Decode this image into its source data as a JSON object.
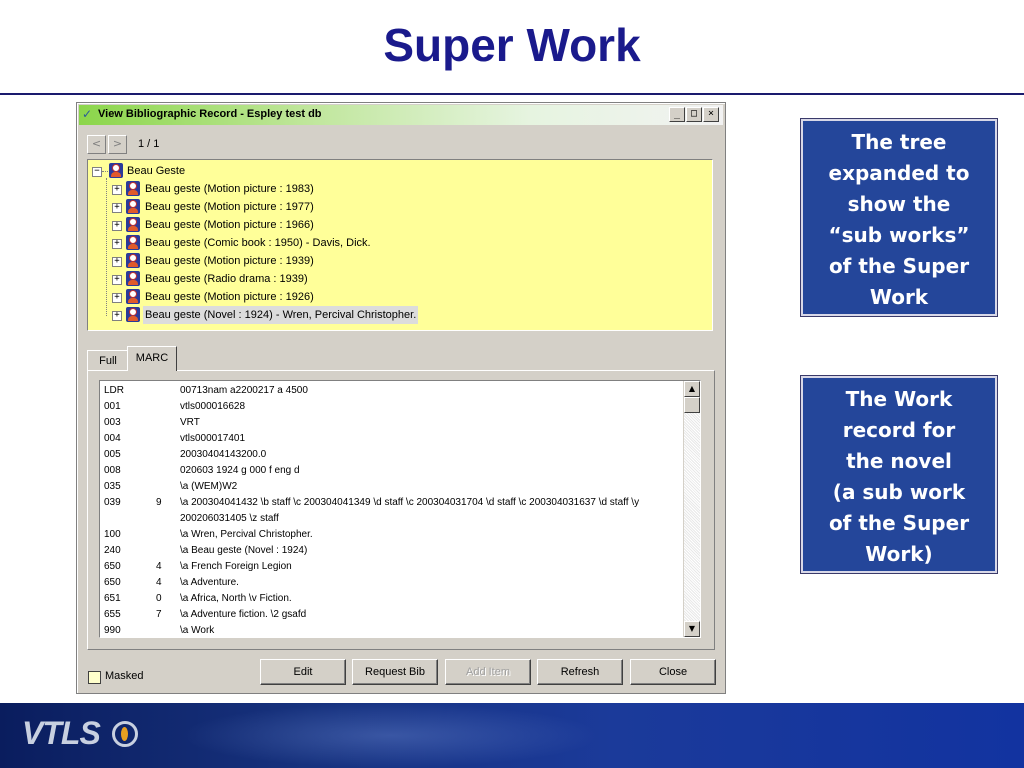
{
  "slide": {
    "title": "Super Work"
  },
  "window": {
    "title": "View Bibliographic Record - Espley test db",
    "buttons": {
      "minimize": "_",
      "maximize": "□",
      "close": "×"
    },
    "nav": {
      "prev": "<",
      "next": ">",
      "pager": "1 / 1"
    },
    "tree": {
      "root": "Beau Geste",
      "children": [
        "Beau geste (Motion picture : 1983)",
        "Beau geste (Motion picture : 1977)",
        "Beau geste (Motion picture : 1966)",
        "Beau geste (Comic book : 1950) - Davis, Dick.",
        "Beau geste (Motion picture : 1939)",
        "Beau geste (Radio drama : 1939)",
        "Beau geste (Motion picture : 1926)",
        "Beau geste (Novel : 1924) - Wren, Percival Christopher."
      ],
      "selected_index": 7
    },
    "tabs": {
      "full": "Full",
      "marc": "MARC",
      "active": "MARC"
    },
    "marc": [
      {
        "tag": "LDR",
        "ind": "",
        "val": "00713nam a2200217 a 4500"
      },
      {
        "tag": "001",
        "ind": "",
        "val": "vtls000016628"
      },
      {
        "tag": "003",
        "ind": "",
        "val": "VRT"
      },
      {
        "tag": "004",
        "ind": "",
        "val": "vtls000017401"
      },
      {
        "tag": "005",
        "ind": "",
        "val": "20030404143200.0"
      },
      {
        "tag": "008",
        "ind": "",
        "val": "020603 1924          g      000 f eng d"
      },
      {
        "tag": "035",
        "ind": "",
        "val": "\\a (WEM)W2"
      },
      {
        "tag": "039",
        "ind": "9",
        "val": "\\a 200304041432 \\b staff \\c 200304041349 \\d staff \\c 200304031704 \\d staff \\c 200304031637 \\d staff \\y"
      },
      {
        "tag": "",
        "ind": "",
        "val": "200206031405 \\z staff"
      },
      {
        "tag": "100",
        "ind": "",
        "val": "\\a Wren, Percival Christopher."
      },
      {
        "tag": "240",
        "ind": "",
        "val": "\\a Beau geste (Novel : 1924)"
      },
      {
        "tag": "650",
        "ind": "4",
        "val": "\\a French Foreign Legion"
      },
      {
        "tag": "650",
        "ind": "4",
        "val": "\\a Adventure."
      },
      {
        "tag": "651",
        "ind": "0",
        "val": "\\a Africa, North \\v Fiction."
      },
      {
        "tag": "655",
        "ind": "7",
        "val": "\\a Adventure fiction. \\2 gsafd"
      },
      {
        "tag": "990",
        "ind": "",
        "val": "\\a Work"
      }
    ],
    "masked_label": "Masked",
    "actions": {
      "edit": "Edit",
      "request_bib": "Request Bib",
      "add_item": "Add Item",
      "refresh": "Refresh",
      "close": "Close"
    }
  },
  "callouts": {
    "first": [
      "The tree",
      "expanded to",
      "show the",
      "“sub works”",
      "of the Super",
      "Work"
    ],
    "second": [
      "The Work",
      "record for",
      "the novel",
      "(a sub work",
      "of the Super",
      "Work)"
    ]
  },
  "footer": {
    "logo": "VTLS"
  },
  "colors": {
    "title": "#1a1a8c",
    "callout_bg": "#24469a",
    "tree_bg": "#ffff99",
    "footer": "#17327e"
  }
}
